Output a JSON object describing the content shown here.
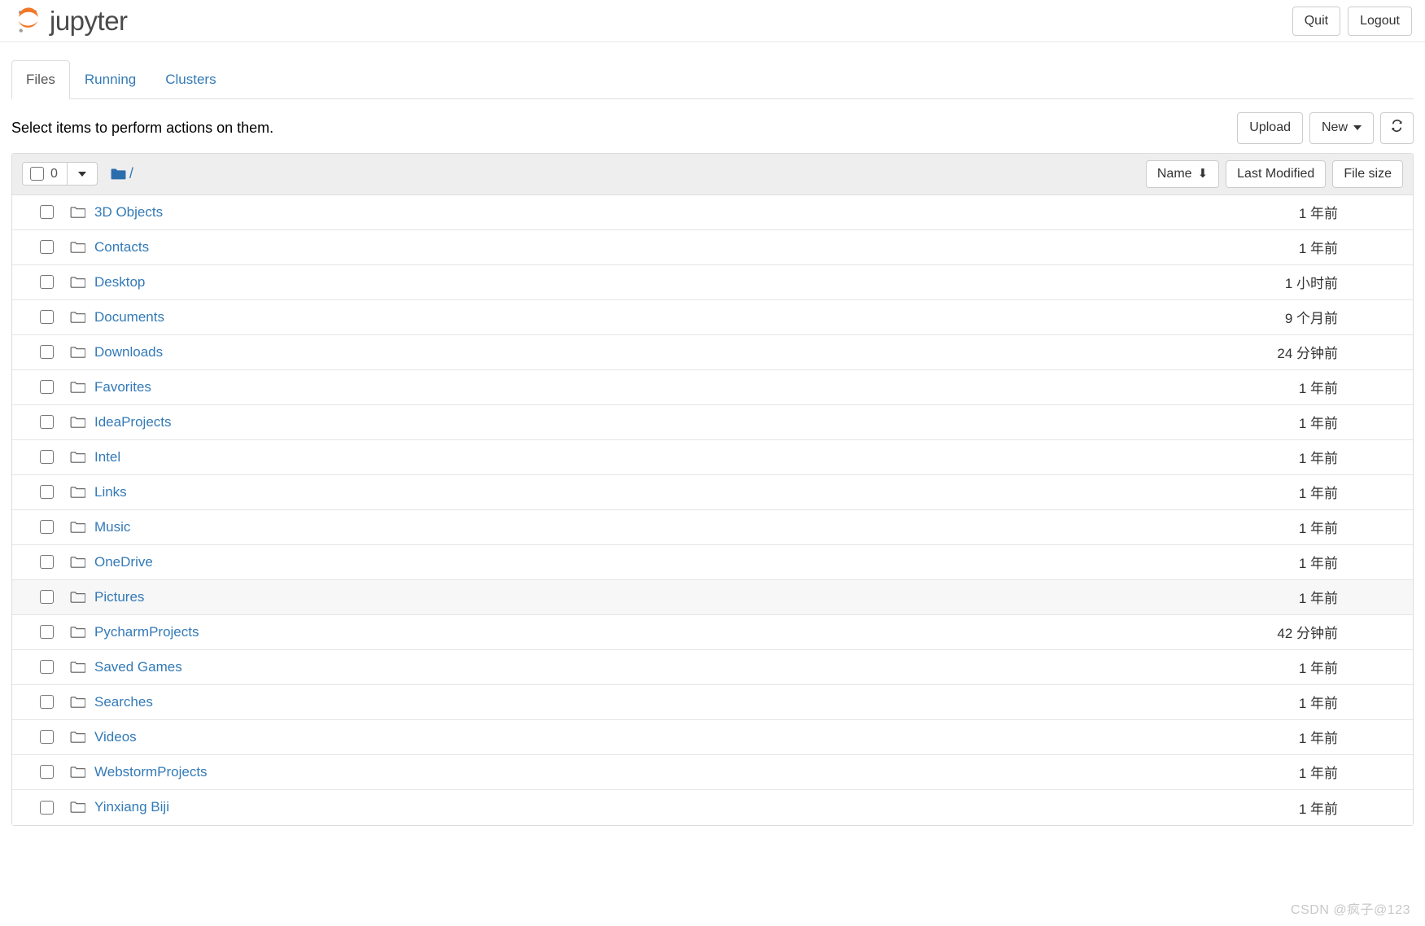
{
  "header": {
    "brand": "jupyter",
    "brand_icon": "jupyter-logo-icon",
    "quit_label": "Quit",
    "logout_label": "Logout"
  },
  "tabs": [
    {
      "label": "Files",
      "active": true
    },
    {
      "label": "Running",
      "active": false
    },
    {
      "label": "Clusters",
      "active": false
    }
  ],
  "action_bar": {
    "instruction": "Select items to perform actions on them.",
    "upload_label": "Upload",
    "new_label": "New",
    "refresh_icon": "refresh-icon"
  },
  "list_header": {
    "selected_count": "0",
    "breadcrumb_root": "/",
    "folder_icon": "folder-solid-icon",
    "sort_name_label": "Name",
    "sort_name_arrow": "⬇",
    "sort_modified_label": "Last Modified",
    "sort_size_label": "File size"
  },
  "colors": {
    "link": "#337ab7",
    "brand_orange": "#f37726",
    "brand_gray": "#4a4a4a",
    "header_bg": "#eeeeee",
    "border": "#dddddd",
    "row_hover": "#f7f7f7",
    "watermark": "#c8c8c8"
  },
  "rows": [
    {
      "name": "3D Objects",
      "icon": "folder-icon",
      "modified": "1 年前",
      "size": "",
      "hovered": false
    },
    {
      "name": "Contacts",
      "icon": "folder-icon",
      "modified": "1 年前",
      "size": "",
      "hovered": false
    },
    {
      "name": "Desktop",
      "icon": "folder-icon",
      "modified": "1 小时前",
      "size": "",
      "hovered": false
    },
    {
      "name": "Documents",
      "icon": "folder-icon",
      "modified": "9 个月前",
      "size": "",
      "hovered": false
    },
    {
      "name": "Downloads",
      "icon": "folder-icon",
      "modified": "24 分钟前",
      "size": "",
      "hovered": false
    },
    {
      "name": "Favorites",
      "icon": "folder-icon",
      "modified": "1 年前",
      "size": "",
      "hovered": false
    },
    {
      "name": "IdeaProjects",
      "icon": "folder-icon",
      "modified": "1 年前",
      "size": "",
      "hovered": false
    },
    {
      "name": "Intel",
      "icon": "folder-icon",
      "modified": "1 年前",
      "size": "",
      "hovered": false
    },
    {
      "name": "Links",
      "icon": "folder-icon",
      "modified": "1 年前",
      "size": "",
      "hovered": false
    },
    {
      "name": "Music",
      "icon": "folder-icon",
      "modified": "1 年前",
      "size": "",
      "hovered": false
    },
    {
      "name": "OneDrive",
      "icon": "folder-icon",
      "modified": "1 年前",
      "size": "",
      "hovered": false
    },
    {
      "name": "Pictures",
      "icon": "folder-icon",
      "modified": "1 年前",
      "size": "",
      "hovered": true
    },
    {
      "name": "PycharmProjects",
      "icon": "folder-icon",
      "modified": "42 分钟前",
      "size": "",
      "hovered": false
    },
    {
      "name": "Saved Games",
      "icon": "folder-icon",
      "modified": "1 年前",
      "size": "",
      "hovered": false
    },
    {
      "name": "Searches",
      "icon": "folder-icon",
      "modified": "1 年前",
      "size": "",
      "hovered": false
    },
    {
      "name": "Videos",
      "icon": "folder-icon",
      "modified": "1 年前",
      "size": "",
      "hovered": false
    },
    {
      "name": "WebstormProjects",
      "icon": "folder-icon",
      "modified": "1 年前",
      "size": "",
      "hovered": false
    },
    {
      "name": "Yinxiang Biji",
      "icon": "folder-icon",
      "modified": "1 年前",
      "size": "",
      "hovered": false
    }
  ],
  "watermark": {
    "text": "CSDN @疯子@123"
  }
}
